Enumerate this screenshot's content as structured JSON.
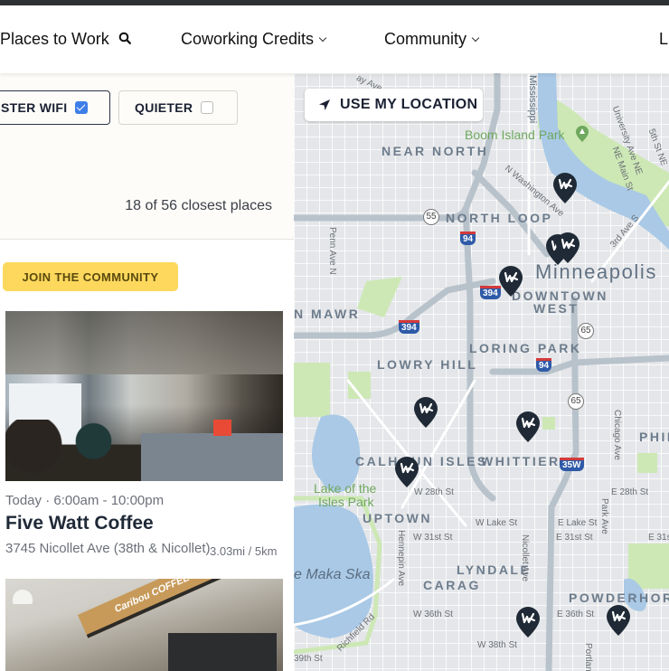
{
  "nav": {
    "items": [
      {
        "label": "Places to Work",
        "icon": "search-icon"
      },
      {
        "label": "Coworking Credits",
        "icon": "chevron-down-icon"
      },
      {
        "label": "Community",
        "icon": "chevron-down-icon"
      },
      {
        "label": "L"
      }
    ]
  },
  "filters": [
    {
      "label": "STER WIFI",
      "checked": true
    },
    {
      "label": "QUIETER",
      "checked": false
    }
  ],
  "results_count": "18 of 56 closest places",
  "join_button": "JOIN THE COMMUNITY",
  "places": [
    {
      "hours": "Today · 6:00am - 10:00pm",
      "name": "Five Watt Coffee",
      "address": "3745 Nicollet Ave (38th & Nicollet)",
      "distance": "3.03mi / 5km"
    },
    {
      "sign_text": "Caribou COFFEE"
    }
  ],
  "map": {
    "location_button": "USE MY LOCATION",
    "city": "Minneapolis",
    "neighborhoods": [
      "NEAR NORTH",
      "NORTH LOOP",
      "DOWNTOWN",
      "WEST",
      "N MAWR",
      "LORING PARK",
      "LOWRY HILL",
      "CALHOUN ISLES",
      "WHITTIER",
      "PHIL",
      "UPTOWN",
      "LYNDALE",
      "CARAG",
      "POWDERHORN"
    ],
    "parks": [
      "Boom Island Park",
      "Lake of the",
      "Isles Park"
    ],
    "water": [
      "Mississippi",
      "e Maka Ska"
    ],
    "streets": [
      "Penn Ave N",
      "N Washington Ave",
      "University Ave NE",
      "NE Main St",
      "5th St NE",
      "3rd Ave S",
      "Hennepin Ave",
      "Nicollet Ave",
      "Chicago Ave",
      "Park Ave",
      "Portland",
      "W 28th St",
      "E 28th St",
      "W Lake St",
      "E Lake St",
      "W 31st St",
      "E 31st St",
      "E 31s",
      "W 36th St",
      "E 36th St",
      "W 38th St",
      "Richfield Rd",
      "39th St",
      "ay Ave"
    ],
    "highways": [
      "94",
      "394",
      "394",
      "94",
      "35W"
    ],
    "routes": [
      "55",
      "65",
      "65"
    ],
    "pin_count": 10
  }
}
